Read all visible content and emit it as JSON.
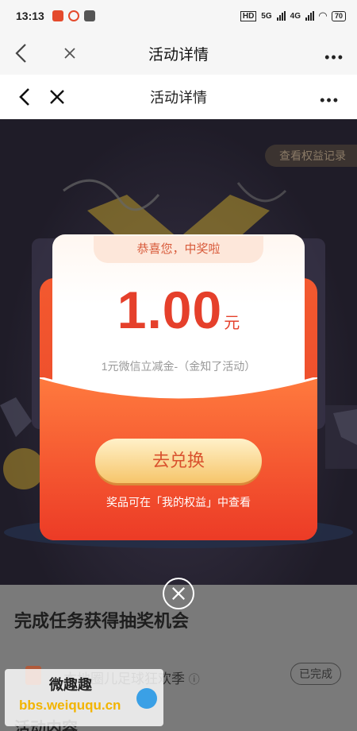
{
  "status_bar": {
    "time": "13:13",
    "network": "5G",
    "network2": "4G",
    "hd": "HD",
    "battery": "70"
  },
  "nav_outer": {
    "title": "活动详情",
    "more": "•••"
  },
  "nav_inner": {
    "title": "活动详情",
    "more": "•••"
  },
  "stage": {
    "record_link": "查看权益记录"
  },
  "prize": {
    "banner": "恭喜您，中奖啦",
    "amount": "1.00",
    "unit": "元",
    "description": "1元微信立减金-（金知了活动）",
    "redeem_label": "去兑换",
    "hint": "奖品可在「我的权益」中查看"
  },
  "background_content": {
    "task_section_title": "完成任务获得抽奖机会",
    "task_name": "本地圈儿足球狂欢季",
    "task_info_icon": "ⓘ",
    "task_status": "已完成",
    "section2_title": "活动内容"
  },
  "watermark": {
    "line1": "微趣趣",
    "line2": "bbs.weiququ.cn"
  },
  "colors": {
    "accent": "#e5402b",
    "envelope": "#f3592f",
    "button": "#f6c56a",
    "dark_bg": "#1f1c28"
  }
}
